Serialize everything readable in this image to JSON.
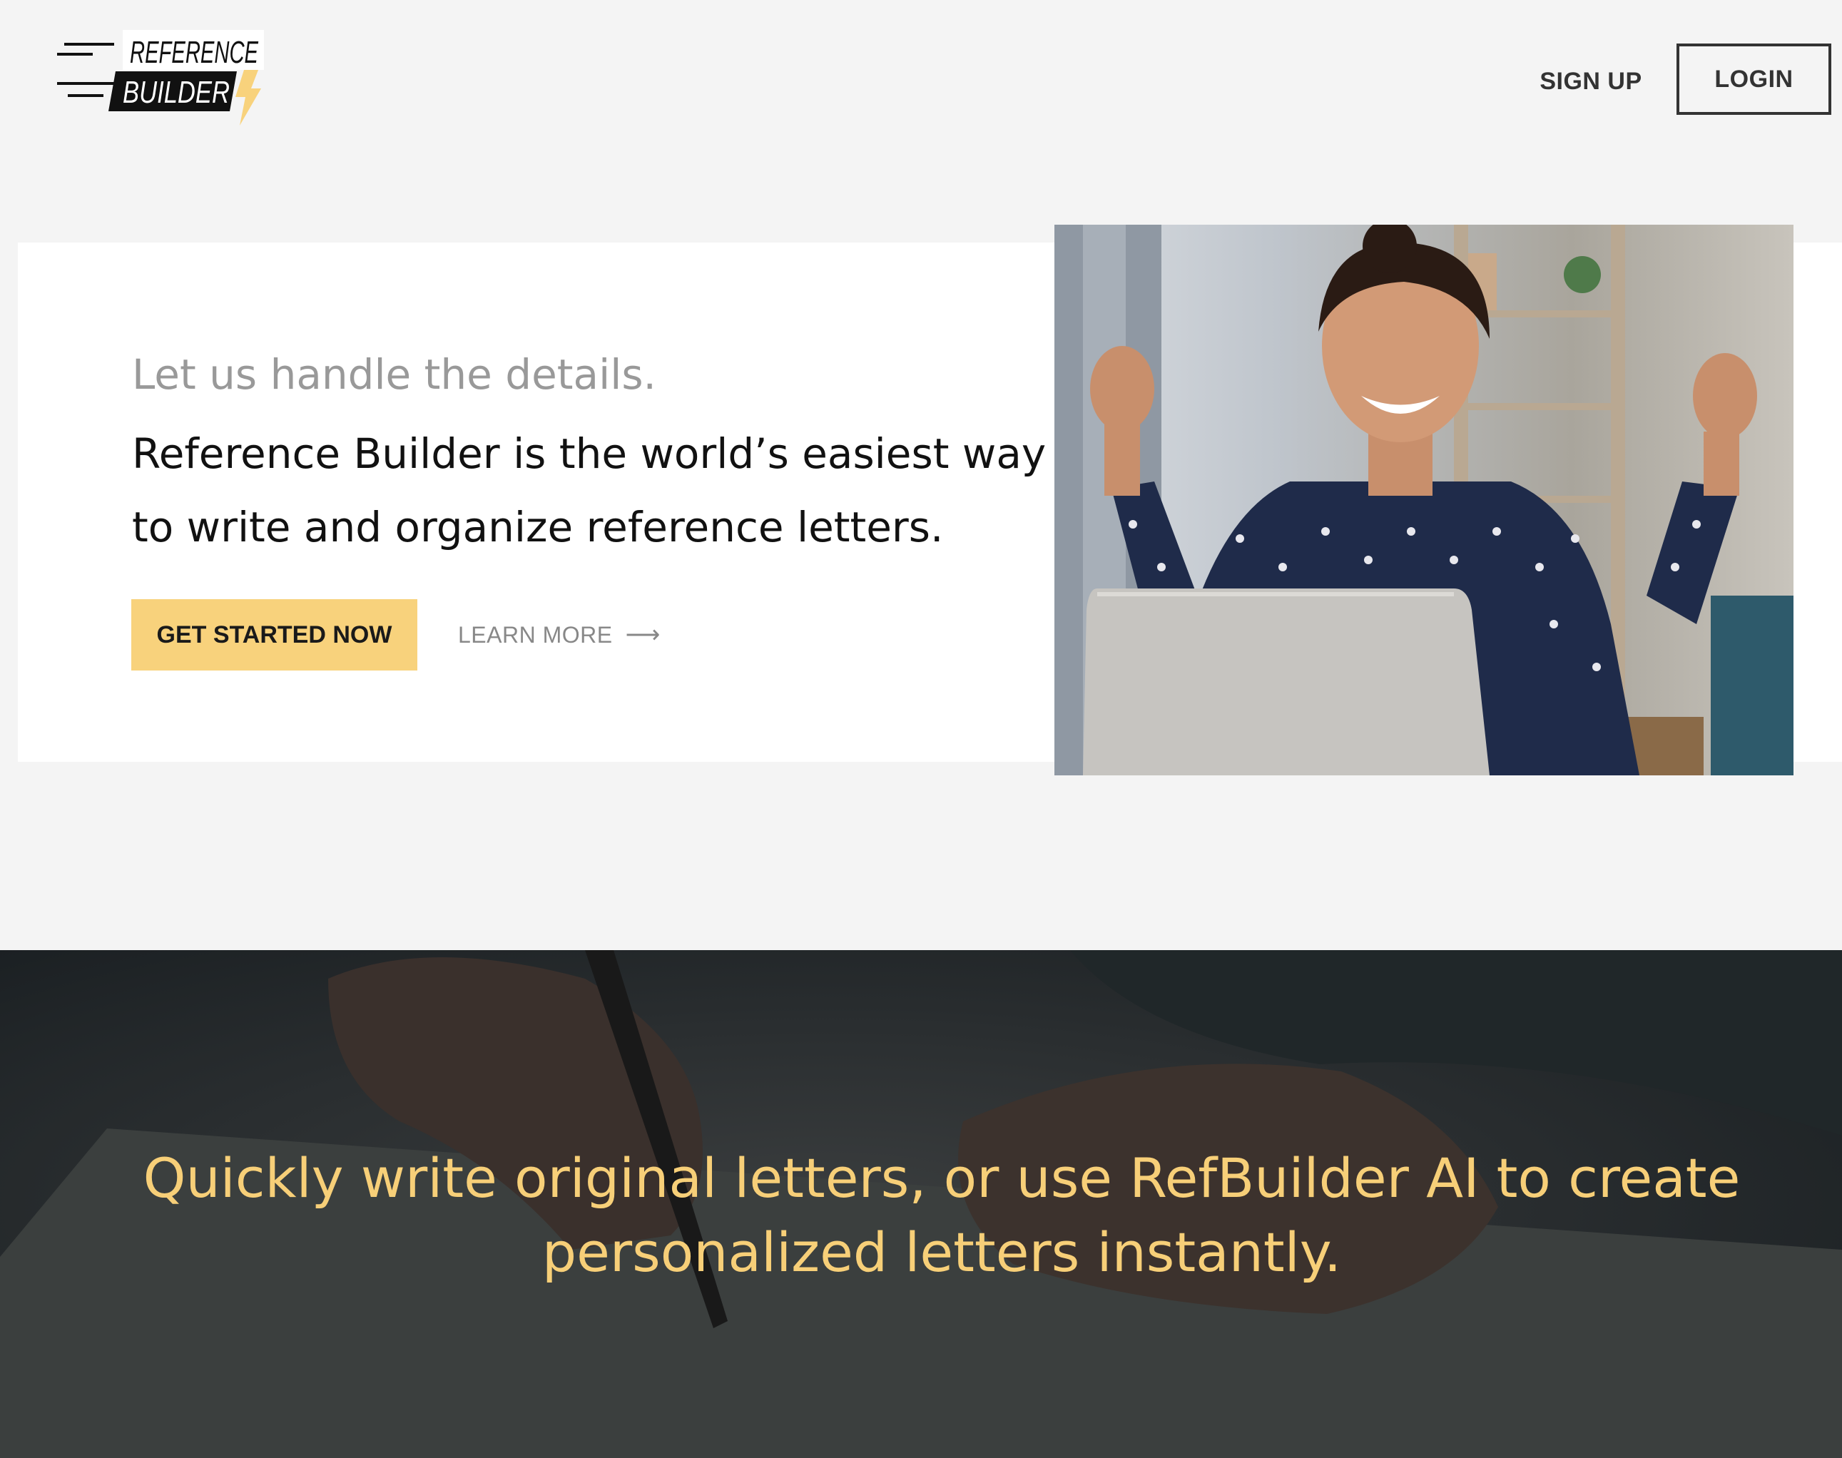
{
  "header": {
    "logo_lines": [
      "REFERENCE",
      "BUILDER"
    ],
    "signup_label": "SIGN UP",
    "login_label": "LOGIN"
  },
  "hero": {
    "subtitle": "Let us handle the details.",
    "headline": "Reference Builder is the world’s easiest way to write and organize reference letters.",
    "cta_label": "GET STARTED NOW",
    "learn_more_label": "LEARN MORE",
    "learn_more_icon": "arrow-right-icon",
    "photo_icon": "celebrating-woman-photo"
  },
  "feature_band": {
    "text": "Quickly write original letters, or use RefBuilder AI to create personalized letters instantly.",
    "background_icon": "hand-writing-letter-photo"
  },
  "colors": {
    "page_bg": "#f4f4f4",
    "accent_yellow": "#f8d27c",
    "band_text": "#f7cf78",
    "dark_text": "#111111",
    "muted_text": "#999999"
  }
}
